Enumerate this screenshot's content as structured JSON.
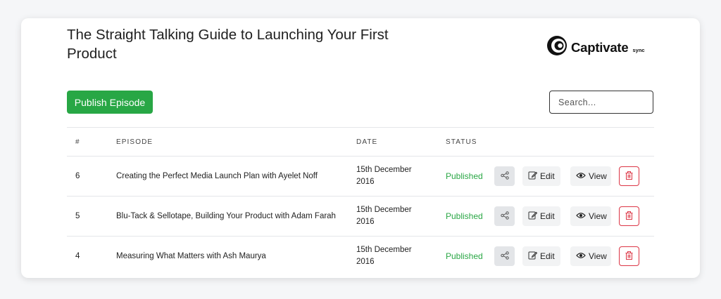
{
  "podcast": {
    "title": "The Straight Talking Guide to Launching Your First Product"
  },
  "logo": {
    "brand": "Captivate",
    "sub": "sync",
    "icon": "captivate-logo-icon"
  },
  "toolbar": {
    "publish_label": "Publish Episode",
    "search_placeholder": "Search..."
  },
  "table": {
    "headers": {
      "num": "#",
      "episode": "EPISODE",
      "date": "DATE",
      "status": "STATUS"
    },
    "rows": [
      {
        "num": "6",
        "episode": "Creating the Perfect Media Launch Plan with Ayelet Noff",
        "date": "15th December 2016",
        "status": "Published",
        "edit_label": "Edit",
        "view_label": "View"
      },
      {
        "num": "5",
        "episode": "Blu-Tack & Sellotape, Building Your Product with Adam Farah",
        "date": "15th December 2016",
        "status": "Published",
        "edit_label": "Edit",
        "view_label": "View"
      },
      {
        "num": "4",
        "episode": "Measuring What Matters with Ash Maurya",
        "date": "15th December 2016",
        "status": "Published",
        "edit_label": "Edit",
        "view_label": "View"
      }
    ]
  },
  "colors": {
    "publish_button": "#28a745",
    "published_status": "#2aa745",
    "delete_border": "#dc3545",
    "share_button_bg": "#e3e5e8"
  },
  "icons": {
    "share": "share-icon",
    "edit": "edit-icon",
    "view": "eye-icon",
    "delete": "trash-icon"
  }
}
